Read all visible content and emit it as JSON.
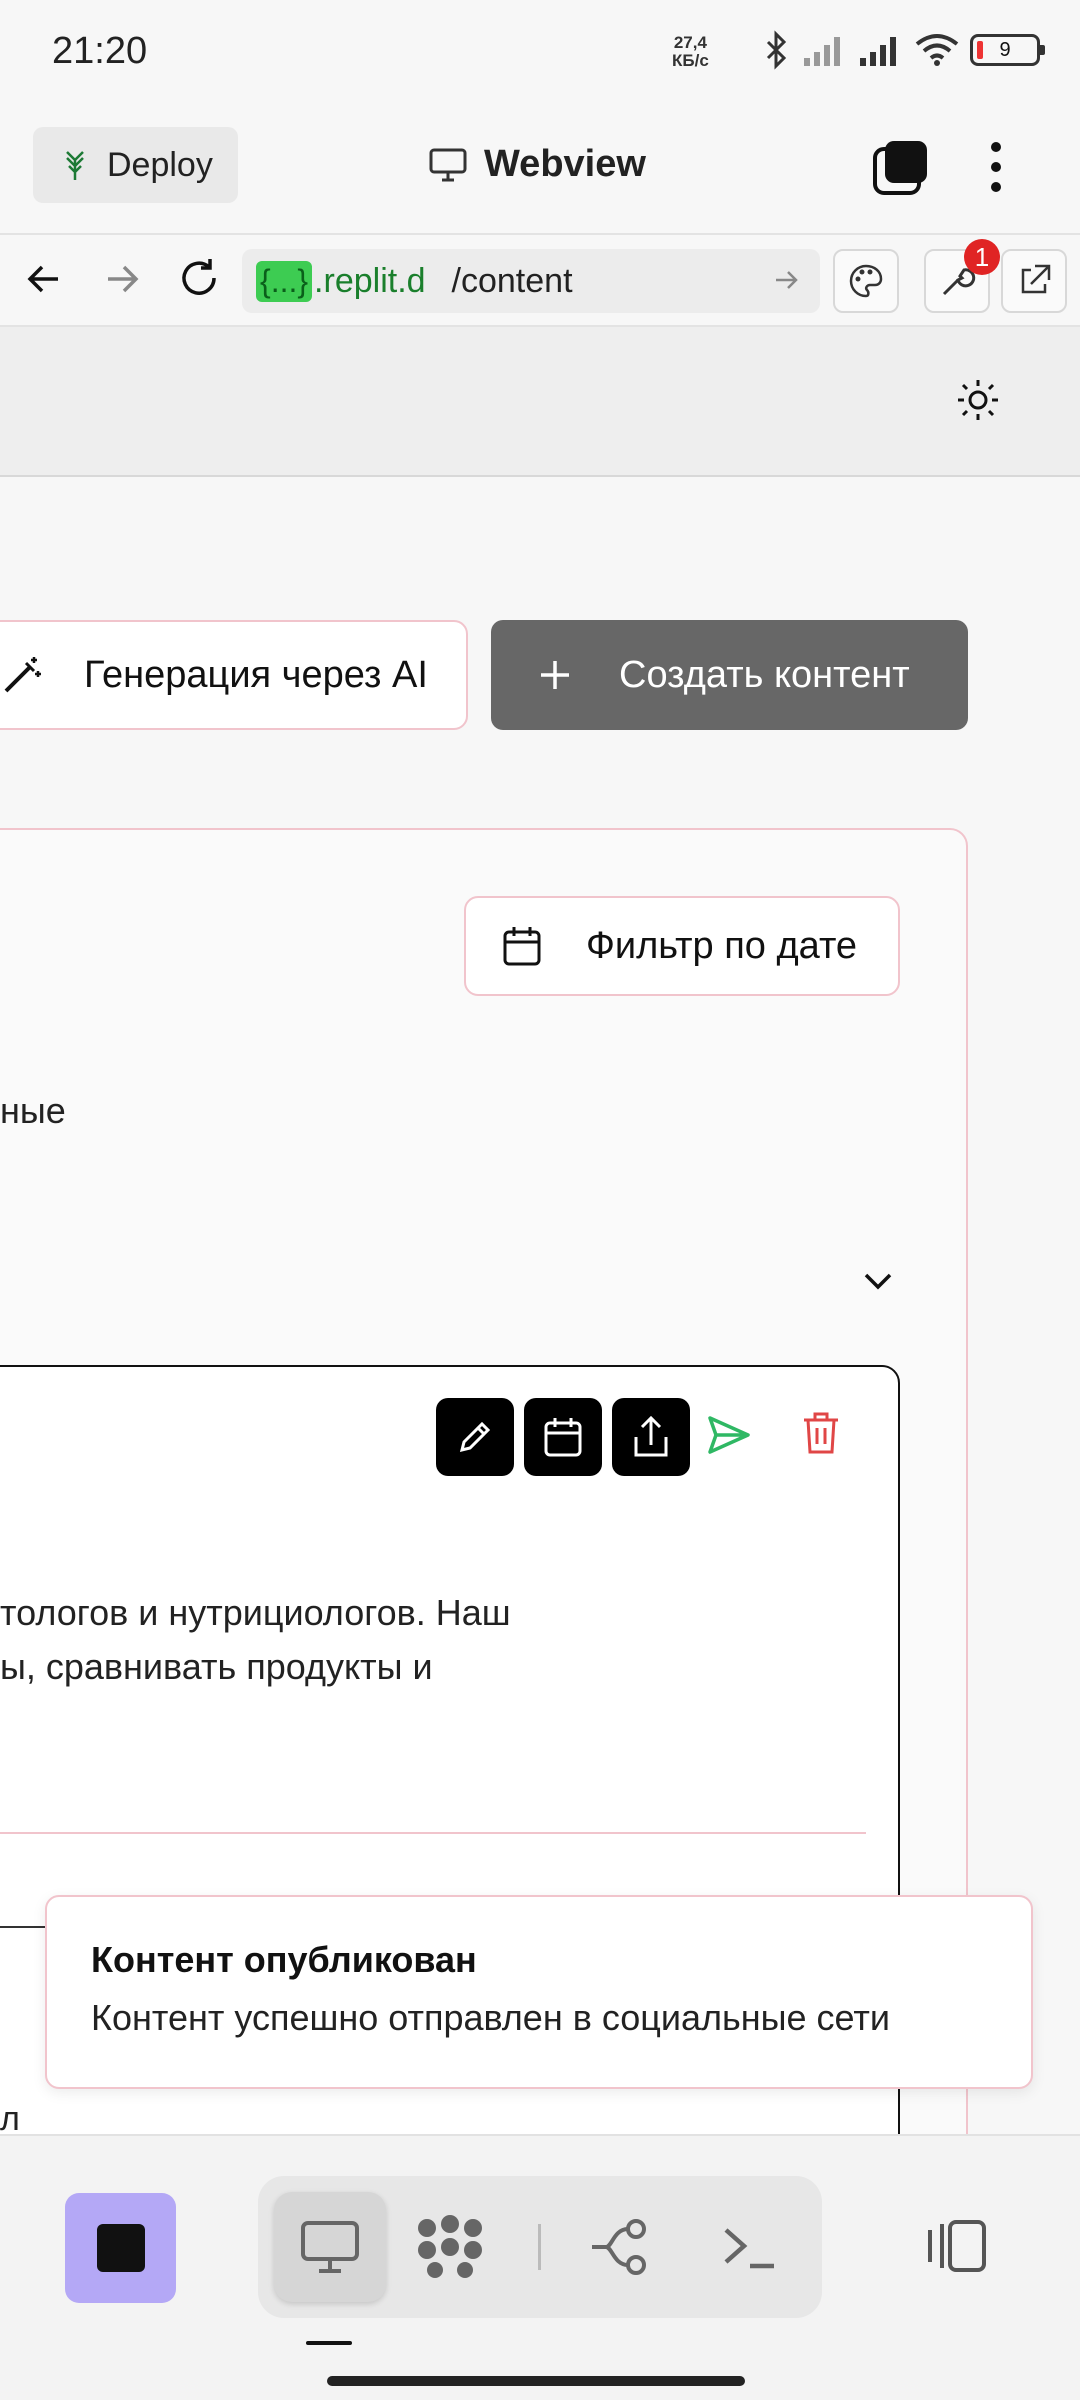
{
  "status_bar": {
    "time": "21:20",
    "net_speed_value": "27,4",
    "net_speed_unit": "КБ/с",
    "battery_level": "9"
  },
  "header": {
    "deploy_label": "Deploy",
    "title": "Webview"
  },
  "url_bar": {
    "chip": "{...}",
    "host": ".replit.d",
    "path": "/content",
    "devtools_badge": "1"
  },
  "toolbar": {
    "ai_generate_label": "Генерация через AI",
    "create_content_label": "Создать контент"
  },
  "filters": {
    "date_filter_label": "Фильтр по дате",
    "status_fragment": "ные"
  },
  "content_item": {
    "description_line_1": "тологов и нутрициологов. Наш",
    "description_line_2": "ы, сравнивать продукты и",
    "stub_text": "л"
  },
  "toast": {
    "title": "Контент опубликован",
    "message": "Контент успешно отправлен в социальные сети"
  },
  "colors": {
    "create_button_bg": "#676767",
    "card_border": "#f1c4cc",
    "stop_button_bg": "#b4a8f6",
    "send_icon": "#2fb864",
    "delete_icon": "#e04646",
    "url_chip": "#3dcc52"
  }
}
